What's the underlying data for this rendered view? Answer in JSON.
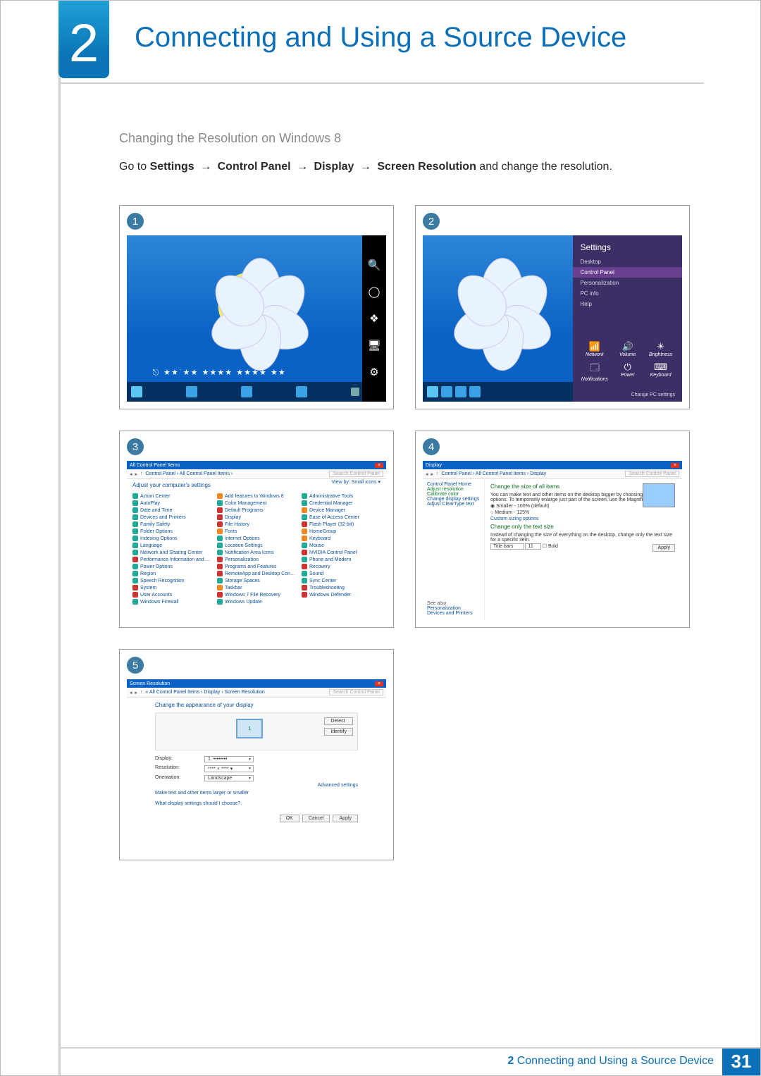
{
  "chapter": {
    "number": "2",
    "title": "Connecting and Using a Source Device"
  },
  "section": {
    "subtitle": "Changing the Resolution on Windows 8"
  },
  "instruction": {
    "prefix": "Go to ",
    "path": [
      "Settings",
      "Control Panel",
      "Display",
      "Screen Resolution"
    ],
    "arrow": "→",
    "suffix": " and change the resolution."
  },
  "steps": {
    "s1": {
      "num": "1"
    },
    "s2": {
      "num": "2"
    },
    "s3": {
      "num": "3"
    },
    "s4": {
      "num": "4"
    },
    "s5": {
      "num": "5"
    }
  },
  "charms": {
    "search": "🔍",
    "share": "◯",
    "start": "❖",
    "devices": "🖥",
    "settings": "⚙"
  },
  "stars": "⎋  ★★˙★★    ★★★★\n                 ★★★★ ★★",
  "settingsPane": {
    "title": "Settings",
    "items": {
      "desktop": "Desktop",
      "controlPanel": "Control Panel",
      "personalization": "Personalization",
      "pcinfo": "PC info",
      "help": "Help"
    },
    "icons": {
      "network": {
        "glyph": "📶",
        "label": "Network"
      },
      "volume": {
        "glyph": "🔊",
        "label": "Volume"
      },
      "bright": {
        "glyph": "☀",
        "label": "Brightness"
      },
      "notif": {
        "glyph": "🗔",
        "label": "Notifications"
      },
      "power": {
        "glyph": "⏻",
        "label": "Power"
      },
      "keyboard": {
        "glyph": "⌨",
        "label": "Keyboard"
      }
    },
    "changePC": "Change PC settings"
  },
  "controlPanel": {
    "windowTitle": "All Control Panel Items",
    "breadcrumb": "Control Panel  ›  All Control Panel Items  ›",
    "searchPlaceholder": "Search Control Panel",
    "adjust": "Adjust your computer's settings",
    "viewby": "View by:  Small icons ▾",
    "items": [
      {
        "c": "#2a9",
        "t": "Action Center"
      },
      {
        "c": "#2a9",
        "t": "AutoPlay"
      },
      {
        "c": "#2a9",
        "t": "Date and Time"
      },
      {
        "c": "#2a9",
        "t": "Devices and Printers"
      },
      {
        "c": "#2a9",
        "t": "Family Safety"
      },
      {
        "c": "#2a9",
        "t": "Folder Options"
      },
      {
        "c": "#2a9",
        "t": "Indexing Options"
      },
      {
        "c": "#2a9",
        "t": "Language"
      },
      {
        "c": "#2a9",
        "t": "Network and Sharing Center"
      },
      {
        "c": "#c33",
        "t": "Performance Information and Tools"
      },
      {
        "c": "#2a9",
        "t": "Power Options"
      },
      {
        "c": "#2a9",
        "t": "Region"
      },
      {
        "c": "#2a9",
        "t": "Speech Recognition"
      },
      {
        "c": "#c33",
        "t": "System"
      },
      {
        "c": "#c33",
        "t": "User Accounts"
      },
      {
        "c": "#2a9",
        "t": "Windows Firewall"
      },
      {
        "c": "#e82",
        "t": "Add features to Windows 8"
      },
      {
        "c": "#2a9",
        "t": "Color Management"
      },
      {
        "c": "#c33",
        "t": "Default Programs"
      },
      {
        "c": "#c33",
        "t": "Display"
      },
      {
        "c": "#c33",
        "t": "File History"
      },
      {
        "c": "#e82",
        "t": "Fonts"
      },
      {
        "c": "#2a9",
        "t": "Internet Options"
      },
      {
        "c": "#2a9",
        "t": "Location Settings"
      },
      {
        "c": "#2a9",
        "t": "Notification Area Icons"
      },
      {
        "c": "#c33",
        "t": "Personalization"
      },
      {
        "c": "#c33",
        "t": "Programs and Features"
      },
      {
        "c": "#c33",
        "t": "RemoteApp and Desktop Connections"
      },
      {
        "c": "#2a9",
        "t": "Storage Spaces"
      },
      {
        "c": "#e82",
        "t": "Taskbar"
      },
      {
        "c": "#c33",
        "t": "Windows 7 File Recovery"
      },
      {
        "c": "#2a9",
        "t": "Windows Update"
      },
      {
        "c": "#2a9",
        "t": "Administrative Tools"
      },
      {
        "c": "#2a9",
        "t": "Credential Manager"
      },
      {
        "c": "#e82",
        "t": "Device Manager"
      },
      {
        "c": "#2a9",
        "t": "Ease of Access Center"
      },
      {
        "c": "#c33",
        "t": "Flash Player (32-bit)"
      },
      {
        "c": "#e82",
        "t": "HomeGroup"
      },
      {
        "c": "#e82",
        "t": "Keyboard"
      },
      {
        "c": "#2a9",
        "t": "Mouse"
      },
      {
        "c": "#c33",
        "t": "NVIDIA Control Panel"
      },
      {
        "c": "#2a9",
        "t": "Phone and Modem"
      },
      {
        "c": "#c33",
        "t": "Recovery"
      },
      {
        "c": "#2a9",
        "t": "Sound"
      },
      {
        "c": "#2a9",
        "t": "Sync Center"
      },
      {
        "c": "#c33",
        "t": "Troubleshooting"
      },
      {
        "c": "#c33",
        "t": "Windows Defender"
      }
    ]
  },
  "displayWindow": {
    "windowTitle": "Display",
    "breadcrumb": "Control Panel  ›  All Control Panel Items  ›  Display",
    "searchPlaceholder": "Search Control Panel",
    "left": {
      "home": "Control Panel Home",
      "adjustRes": "Adjust resolution",
      "calibrate": "Calibrate color",
      "changeDisp": "Change display settings",
      "clearType": "Adjust ClearType text"
    },
    "main": {
      "h1": "Change the size of all items",
      "desc": "You can make text and other items on the desktop bigger by choosing one of these options. To temporarily enlarge just part of the screen, use the Magnifier tool.",
      "optSmall": "Smaller - 100% (default)",
      "optMed": "Medium - 125%",
      "custom": "Custom sizing options",
      "h2": "Change only the text size",
      "desc2": "Instead of changing the size of everything on the desktop, change only the text size for a specific item.",
      "titleBars": "Title bars",
      "size": "11",
      "bold": "Bold",
      "apply": "Apply"
    },
    "seeAlso": {
      "label": "See also",
      "personalization": "Personalization",
      "devices": "Devices and Printers"
    }
  },
  "screenRes": {
    "windowTitle": "Screen Resolution",
    "breadcrumb": "« All Control Panel Items  ›  Display  ›  Screen Resolution",
    "searchPlaceholder": "Search Control Panel",
    "heading": "Change the appearance of your display",
    "detect": "Detect",
    "identify": "Identify",
    "monitor": "1",
    "fields": {
      "display": {
        "label": "Display:",
        "value": "1. ••••••••"
      },
      "resolution": {
        "label": "Resolution:",
        "value": "**** × **** ▾"
      },
      "orientation": {
        "label": "Orientation:",
        "value": "Landscape"
      }
    },
    "advanced": "Advanced settings",
    "link1": "Make text and other items larger or smaller",
    "link2": "What display settings should I choose?",
    "ok": "OK",
    "cancel": "Cancel",
    "applyBtn": "Apply"
  },
  "footer": {
    "chapter": "2",
    "title": "Connecting and Using a Source Device",
    "page": "31"
  }
}
